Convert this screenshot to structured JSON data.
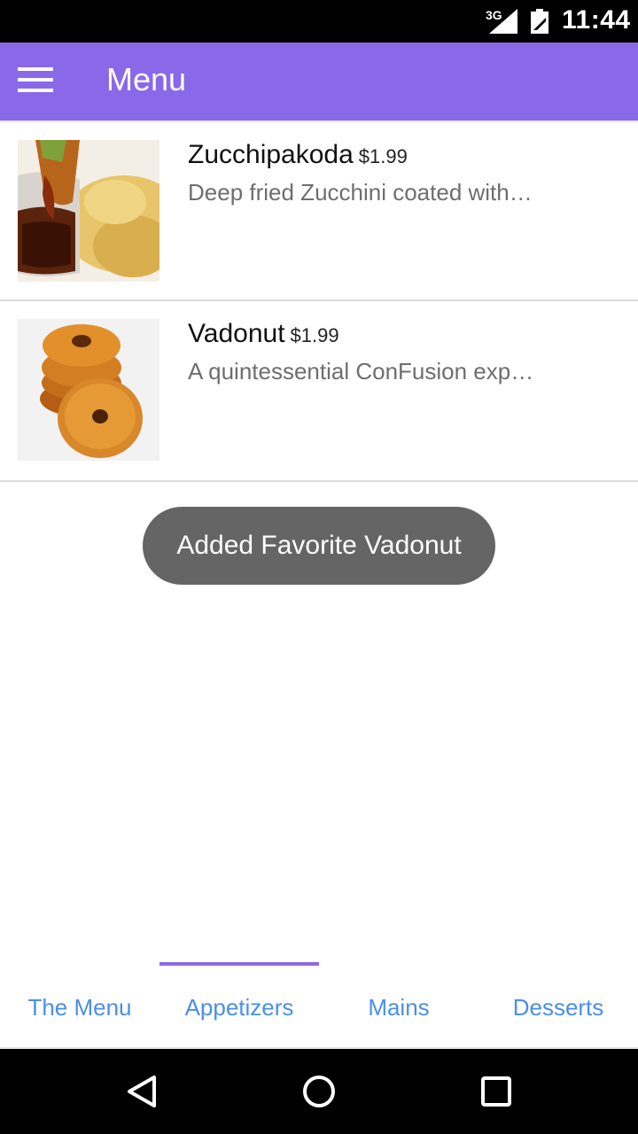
{
  "status_bar": {
    "network": "3G",
    "time": "11:44"
  },
  "app_bar": {
    "title": "Menu",
    "menu_icon": "hamburger-menu-icon",
    "color": "#8a69e8"
  },
  "menu_items": [
    {
      "name": "Zucchipakoda",
      "price": "$1.99",
      "description": "Deep fried Zucchini coated with…",
      "image": "zucchipakoda-photo"
    },
    {
      "name": "Vadonut",
      "price": "$1.99",
      "description": "A quintessential ConFusion exp…",
      "image": "vadonut-photo"
    }
  ],
  "toast": {
    "message": "Added Favorite Vadonut"
  },
  "tabs": [
    {
      "label": "The Menu",
      "active": false
    },
    {
      "label": "Appetizers",
      "active": true
    },
    {
      "label": "Mains",
      "active": false
    },
    {
      "label": "Desserts",
      "active": false
    }
  ],
  "nav_bar": {
    "back_icon": "back-triangle-icon",
    "home_icon": "home-circle-icon",
    "recents_icon": "recents-square-icon"
  },
  "colors": {
    "accent": "#8a69e8",
    "tab_text": "#4a8fe7",
    "toast_bg": "#656565"
  }
}
